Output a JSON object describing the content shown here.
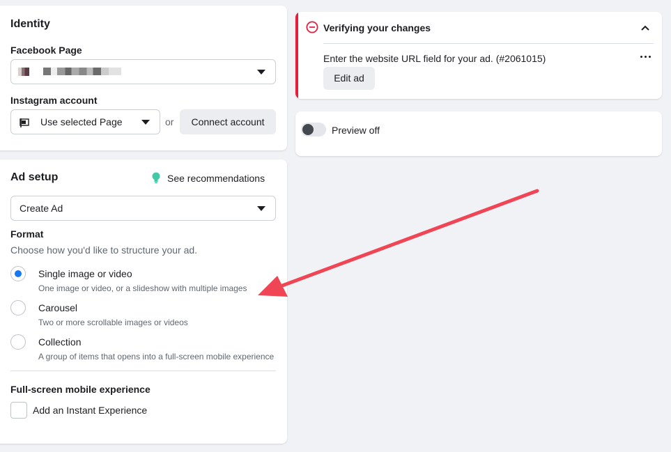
{
  "identity": {
    "title": "Identity",
    "facebook_page_label": "Facebook Page",
    "instagram_label": "Instagram account",
    "instagram_value": "Use selected Page",
    "or_text": "or",
    "connect_button": "Connect account"
  },
  "ad_setup": {
    "title": "Ad setup",
    "recommendations_link": "See recommendations",
    "create_select_value": "Create Ad",
    "format_label": "Format",
    "format_help": "Choose how you'd like to structure your ad.",
    "options": [
      {
        "title": "Single image or video",
        "desc": "One image or video, or a slideshow with multiple images",
        "selected": true
      },
      {
        "title": "Carousel",
        "desc": "Two or more scrollable images or videos",
        "selected": false
      },
      {
        "title": "Collection",
        "desc": "A group of items that opens into a full-screen mobile experience",
        "selected": false
      }
    ],
    "fullscreen_label": "Full-screen mobile experience",
    "instant_experience_label": "Add an Instant Experience"
  },
  "verification": {
    "title": "Verifying your changes",
    "message": "Enter the website URL field for your ad. (#2061015)",
    "edit_button": "Edit ad",
    "more_icon": "more-horizontal-icon"
  },
  "preview": {
    "label": "Preview off",
    "enabled": false
  },
  "colors": {
    "accent": "#1877f2",
    "error": "#e41e3f",
    "annotation_arrow": "#ef4555",
    "bulb": "#42c9a6"
  }
}
